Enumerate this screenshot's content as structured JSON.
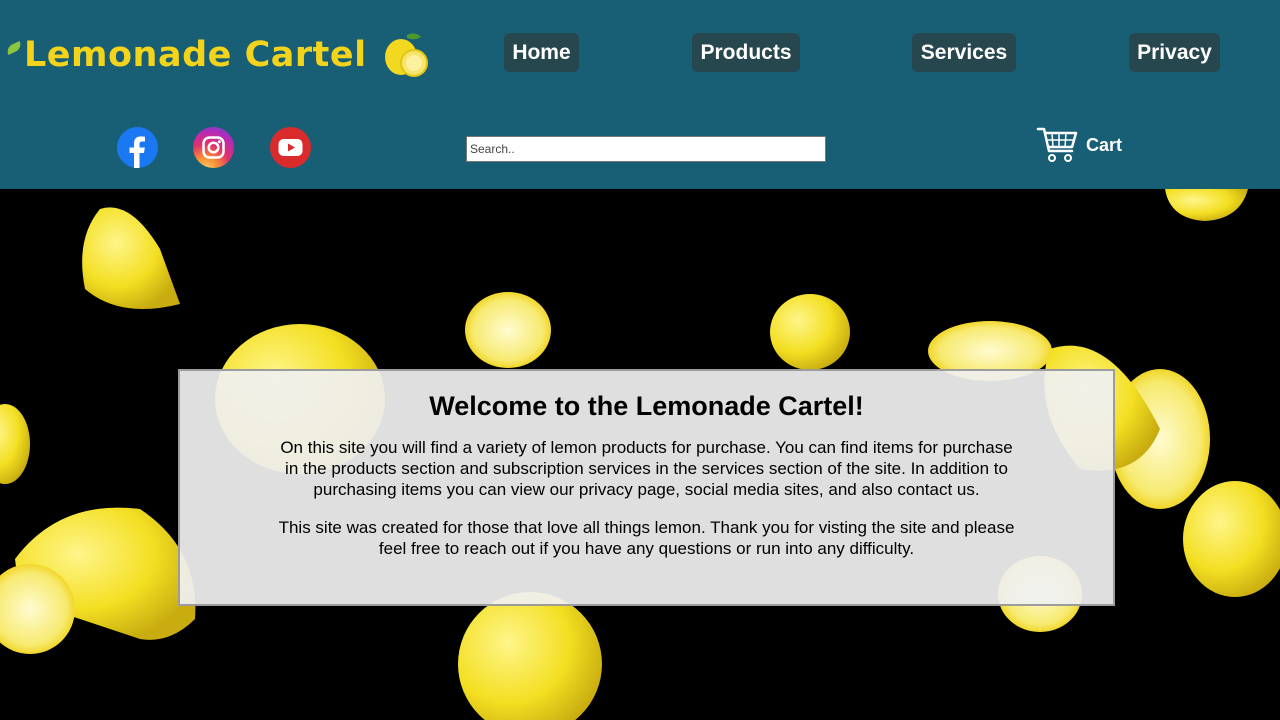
{
  "brand": {
    "name": "Lemonade Cartel",
    "icon": "lemon-icon"
  },
  "nav": [
    {
      "label": "Home"
    },
    {
      "label": "Products"
    },
    {
      "label": "Services"
    },
    {
      "label": "Privacy"
    }
  ],
  "social": [
    {
      "icon": "facebook-icon"
    },
    {
      "icon": "instagram-icon"
    },
    {
      "icon": "youtube-icon"
    }
  ],
  "search": {
    "placeholder": "Search..",
    "value": ""
  },
  "cart": {
    "label": "Cart",
    "icon": "cart-icon"
  },
  "welcome": {
    "title": "Welcome to the Lemonade Cartel!",
    "paragraph1": "On this site you will find a variety of lemon products for purchase. You can find items for purchase in the products section and subscription services in the services section of the site. In addition to purchasing items you can view our privacy page, social media sites, and also contact us.",
    "paragraph2": "This site was created for those that love all things lemon. Thank you for visting the site and please feel free to reach out if you have any questions or run into any difficulty."
  },
  "colors": {
    "header": "#185e75",
    "nav_button": "#27474e",
    "brand_text": "#f3d41b",
    "lemon": "#f5e02c"
  }
}
